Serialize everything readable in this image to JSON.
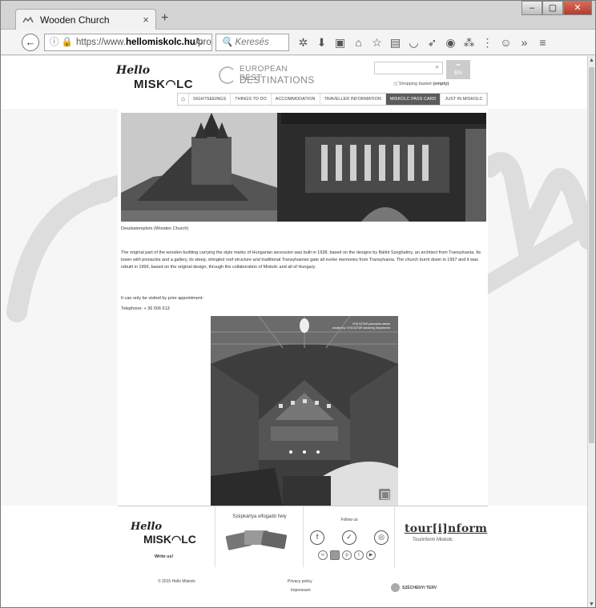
{
  "browser": {
    "tab_title": "Wooden Church",
    "tab_close": "×",
    "new_tab": "+",
    "url_prefix": "https://www.",
    "url_domain": "hellomiskolc.hu",
    "url_path": "/pro",
    "search_placeholder": "Keresés",
    "window_controls": [
      "–",
      "▢",
      "✕"
    ],
    "toolbar_icons": [
      "puzzle-icon",
      "download-icon",
      "youtube-icon",
      "home-icon",
      "bookmark-star-icon",
      "reading-list-icon",
      "pocket-icon",
      "send-icon",
      "globe-icon",
      "addon-icon",
      "more-icon",
      "chat-icon",
      "overflow-icon",
      "menu-icon"
    ]
  },
  "header": {
    "logo_hello": "Hello",
    "logo_miskolc": "MISK◠LC",
    "ebd_line1": "EUROPEAN BEST",
    "ebd_line2": "DESTINATIONS",
    "lang": "EN",
    "basket_label": "Shopping basket",
    "basket_status": "(empty)"
  },
  "nav": {
    "items": [
      "SIGHTSEEINGS",
      "THINGS TO DO",
      "ACCOMMODATION",
      "TRAVELLER INFORMATION",
      "MISKOLC PASS CARD",
      "JUST IN MISKOLC"
    ],
    "active": "MISKOLC PASS CARD"
  },
  "content": {
    "caption": "Deszkatemplom (Wooden Church)",
    "paragraph": "The original part of the wooden building carrying the style marks of Hungarian secession was built in 1938, based on the designs by Bálint Szeghalmy, an architect from Transylvania. Its tower with pinnacles and a gallery, its steep, shingled roof structure and traditional Transylvanian gate all evoke memories from Transylvania. The church burnt down in 1997 and it was rebuilt in 1999, based on the original design, through the collaboration of Miskolc and all of Hungary.",
    "visit": "It can only be visited by prior appointment:",
    "telephone": "Telephone: + 36 506 613",
    "pano_credit1": "VITA SZTAR panorama viewer",
    "pano_credit2": "created by: VITA SZTAR steaming Department"
  },
  "footer": {
    "write_us": "Write us!",
    "szep_label": "Szépkártya elfogadó hely",
    "follow_us": "Follow us",
    "tourinform_logo": "tour[i]nform",
    "tourinform_sub": "Tourinform Miskolc",
    "copyright": "© 2015 Hello Miskolc",
    "privacy": "Privacy policy",
    "impressum": "Impressum",
    "szechenyi": "SZÉCHENYI TERV"
  }
}
